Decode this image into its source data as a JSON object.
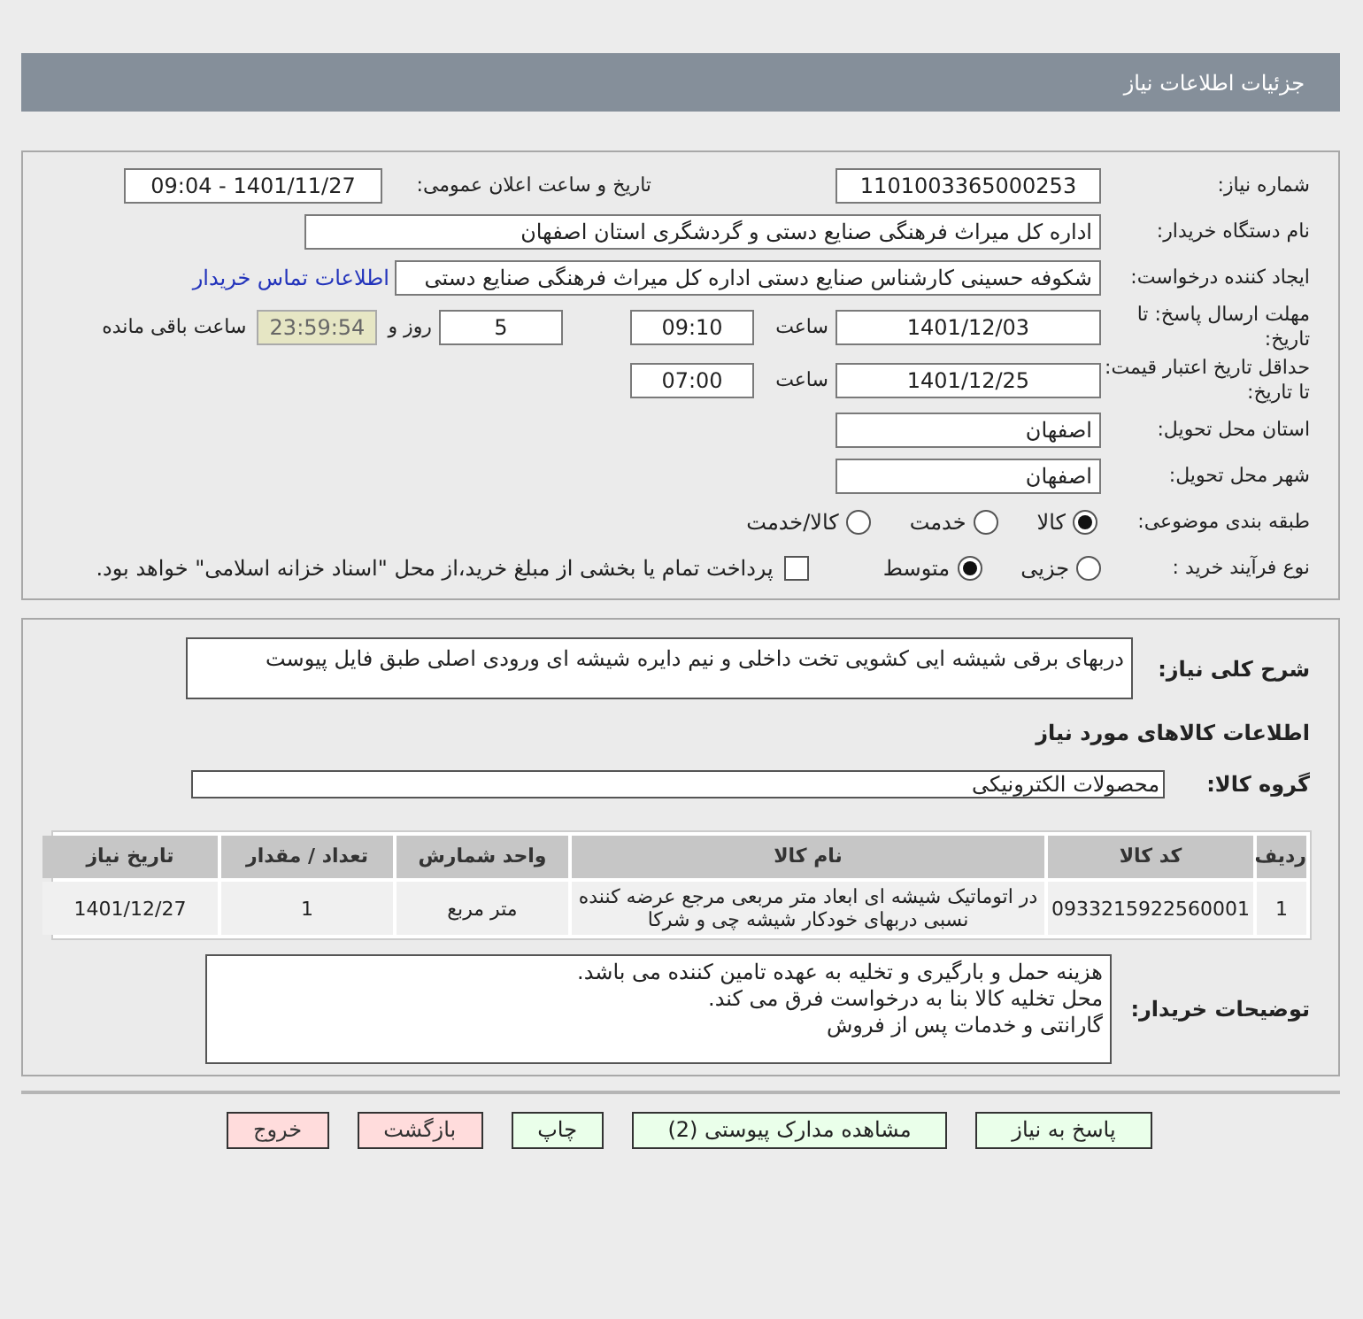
{
  "header": {
    "title": "جزئیات اطلاعات نیاز"
  },
  "need_number": {
    "label": "شماره نیاز:",
    "value": "1101003365000253"
  },
  "announce": {
    "label": "تاریخ و ساعت اعلان عمومی:",
    "value": "1401/11/27 - 09:04"
  },
  "buyer_org": {
    "label": "نام دستگاه خریدار:",
    "value": "اداره کل میراث فرهنگی  صنایع دستی و گردشگری استان اصفهان"
  },
  "requester": {
    "label": "ایجاد کننده درخواست:",
    "value": "شکوفه حسینی کارشناس صنایع دستی اداره کل میراث فرهنگی  صنایع دستی",
    "contact_link": "اطلاعات تماس خریدار"
  },
  "response_deadline": {
    "label": "مهلت ارسال پاسخ: تا تاریخ:",
    "date": "1401/12/03",
    "time_label": "ساعت",
    "time": "09:10",
    "days": "5",
    "days_label": "روز و",
    "remaining": "23:59:54",
    "remaining_label": "ساعت باقی مانده"
  },
  "price_validity": {
    "label": "حداقل تاریخ اعتبار قیمت: تا تاریخ:",
    "date": "1401/12/25",
    "time_label": "ساعت",
    "time": "07:00"
  },
  "province": {
    "label": "استان محل تحویل:",
    "value": "اصفهان"
  },
  "city": {
    "label": "شهر محل تحویل:",
    "value": "اصفهان"
  },
  "category": {
    "label": "طبقه بندی موضوعی:",
    "options": [
      {
        "label": "کالا",
        "selected": true
      },
      {
        "label": "خدمت",
        "selected": false
      },
      {
        "label": "کالا/خدمت",
        "selected": false
      }
    ]
  },
  "process": {
    "label": "نوع فرآیند خرید :",
    "options": [
      {
        "label": "جزیی",
        "selected": false
      },
      {
        "label": "متوسط",
        "selected": true
      }
    ],
    "treasury": {
      "checked": false,
      "text": "پرداخت تمام یا بخشی از مبلغ خرید،از محل \"اسناد خزانه اسلامی\" خواهد بود."
    }
  },
  "description": {
    "label": "شرح کلی نیاز:",
    "value": "دربهای برقی شیشه ایی کشویی تخت داخلی و نیم دایره شیشه ای ورودی اصلی طبق فایل پیوست"
  },
  "items_heading": "اطلاعات کالاهای مورد نیاز",
  "goods_group": {
    "label": "گروه کالا:",
    "value": "محصولات الکترونیکی"
  },
  "table": {
    "columns": [
      "ردیف",
      "کد کالا",
      "نام کالا",
      "واحد شمارش",
      "تعداد / مقدار",
      "تاریخ نیاز"
    ],
    "rows": [
      [
        "1",
        "0933215922560001",
        "در اتوماتیک شیشه ای ابعاد متر مربعی مرجع عرضه کننده نسبی دربهای خودکار شیشه چی و شرکا",
        "متر مربع",
        "1",
        "1401/12/27"
      ]
    ]
  },
  "buyer_notes": {
    "label": "توضیحات خریدار:",
    "lines": [
      "هزینه حمل و بارگیری و تخلیه به عهده تامین کننده می باشد.",
      "محل تخلیه کالا بنا به درخواست فرق می کند.",
      "گارانتی و خدمات پس از فروش"
    ]
  },
  "buttons": [
    {
      "label": "پاسخ به نیاز",
      "kind": "action"
    },
    {
      "label": "مشاهده مدارک پیوستی (2)",
      "kind": "action"
    },
    {
      "label": "چاپ",
      "kind": "action"
    },
    {
      "label": "بازگشت",
      "kind": "danger"
    },
    {
      "label": "خروج",
      "kind": "danger"
    }
  ]
}
